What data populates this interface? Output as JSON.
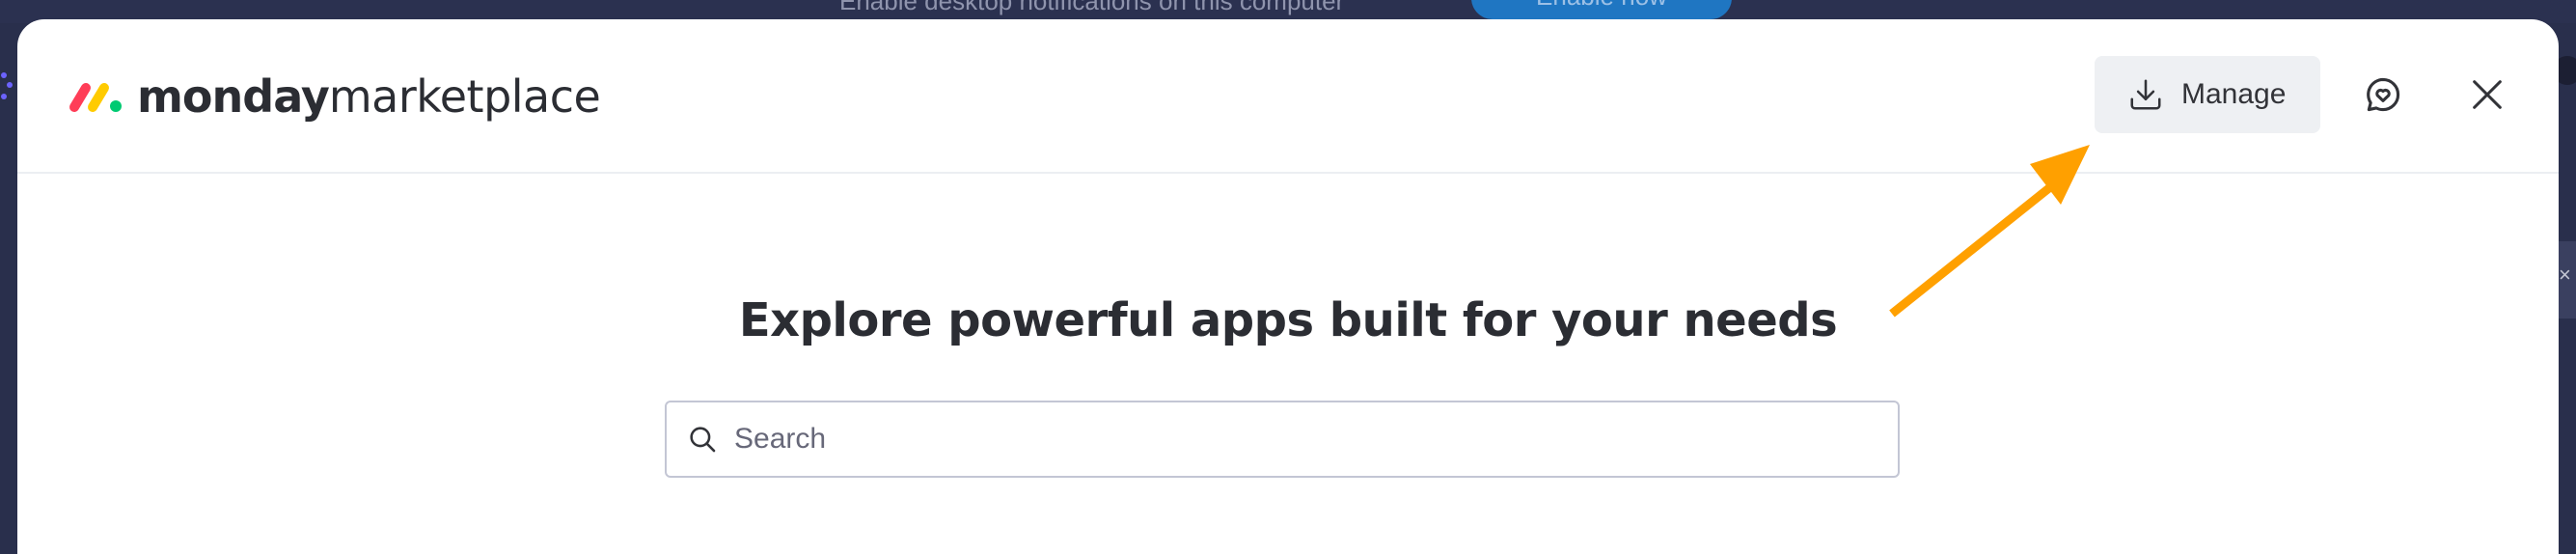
{
  "background": {
    "notice_text": "Enable desktop notifications on this computer",
    "enable_label": "Enable now"
  },
  "header": {
    "logo_brand": "monday",
    "logo_product": "marketplace",
    "manage_label": "Manage",
    "icons": {
      "manage": "download-icon",
      "feedback": "chat-heart-icon",
      "close": "close-icon"
    }
  },
  "main": {
    "headline": "Explore powerful apps built for your needs",
    "search": {
      "placeholder": "Search",
      "value": "",
      "icon": "search-icon"
    }
  },
  "annotation": {
    "arrow_color": "#ffa000"
  },
  "colors": {
    "logo_red": "#ff3d57",
    "logo_yellow": "#ffcb00",
    "logo_green": "#00ca72"
  }
}
